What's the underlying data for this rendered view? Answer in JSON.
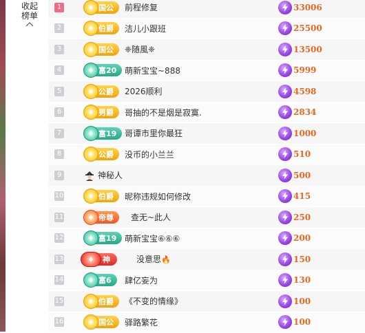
{
  "sidebar": {
    "collapse_label": "收起榜单"
  },
  "colors": {
    "score": "#e8671e",
    "rank_top": "#f06a8a",
    "rank_default": "#cfcfd3"
  },
  "rows": [
    {
      "rank": "1",
      "badge": "国公",
      "badge_style": "gold",
      "name": "前程修复",
      "score": "33006"
    },
    {
      "rank": "2",
      "badge": "伯爵",
      "badge_style": "gold",
      "name": "洁儿小跟班",
      "score": "25500"
    },
    {
      "rank": "3",
      "badge": "国公",
      "badge_style": "gold",
      "name": "❈随風❈",
      "score": "13500"
    },
    {
      "rank": "4",
      "badge": "富20",
      "badge_style": "teal",
      "name": "萌新宝宝~888",
      "score": "5999"
    },
    {
      "rank": "5",
      "badge": "公爵",
      "badge_style": "gold",
      "name": "2026顺利",
      "score": "4598"
    },
    {
      "rank": "6",
      "badge": "男爵",
      "badge_style": "gold",
      "name": "哥抽的不是烟是寂寞.",
      "score": "2834"
    },
    {
      "rank": "7",
      "badge": "富19",
      "badge_style": "teal",
      "name": "哥谭市里你最狂",
      "score": "1000"
    },
    {
      "rank": "8",
      "badge": "公爵",
      "badge_style": "gold",
      "name": "没币的小兰兰",
      "score": "510"
    },
    {
      "rank": "9",
      "badge": "",
      "badge_style": "mystery",
      "name": "神秘人",
      "score": "500"
    },
    {
      "rank": "10",
      "badge": "伯爵",
      "badge_style": "gold",
      "name": "昵称违规如何修改",
      "score": "415"
    },
    {
      "rank": "11",
      "badge": "帝尊",
      "badge_style": "orange",
      "name": "查无~此人",
      "score": "250"
    },
    {
      "rank": "12",
      "badge": "富19",
      "badge_style": "teal",
      "name": "萌新宝宝⑥⑥⑥",
      "score": "200"
    },
    {
      "rank": "13",
      "badge": "神",
      "badge_style": "red",
      "name": "没意思",
      "name_suffix": "🔥",
      "score": "150"
    },
    {
      "rank": "14",
      "badge": "富6",
      "badge_style": "teal",
      "name": "肆亿妄为",
      "score": "130"
    },
    {
      "rank": "15",
      "badge": "伯爵",
      "badge_style": "gold",
      "name": "《不变的情缘》",
      "score": "100"
    },
    {
      "rank": "16",
      "badge": "国公",
      "badge_style": "gold",
      "name": "驿路繁花",
      "score": "100"
    }
  ]
}
